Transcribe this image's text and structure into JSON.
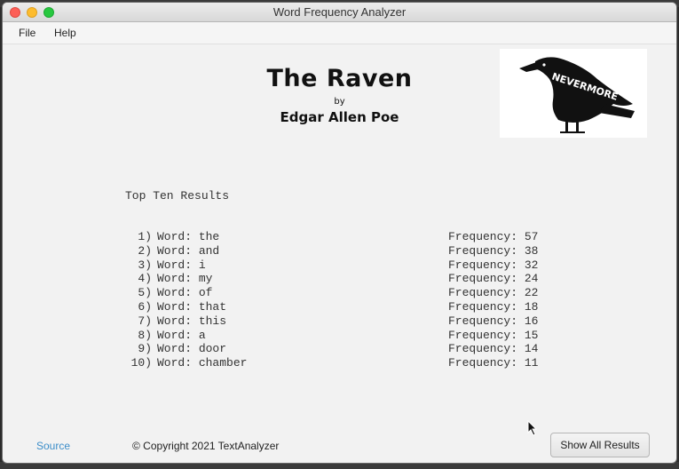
{
  "window": {
    "title": "Word Frequency Analyzer"
  },
  "menu": {
    "file": "File",
    "help": "Help"
  },
  "header": {
    "title": "The Raven",
    "by": "by",
    "author": "Edgar Allen Poe",
    "logo_text": "NEVERMORE"
  },
  "results": {
    "heading": "Top Ten Results",
    "word_prefix": "Word:",
    "freq_prefix": "Frequency:",
    "rows": [
      {
        "rank": "1)",
        "word": "the",
        "frequency": "57"
      },
      {
        "rank": "2)",
        "word": "and",
        "frequency": "38"
      },
      {
        "rank": "3)",
        "word": "i",
        "frequency": "32"
      },
      {
        "rank": "4)",
        "word": "my",
        "frequency": "24"
      },
      {
        "rank": "5)",
        "word": "of",
        "frequency": "22"
      },
      {
        "rank": "6)",
        "word": "that",
        "frequency": "18"
      },
      {
        "rank": "7)",
        "word": "this",
        "frequency": "16"
      },
      {
        "rank": "8)",
        "word": "a",
        "frequency": "15"
      },
      {
        "rank": "9)",
        "word": "door",
        "frequency": "14"
      },
      {
        "rank": "10)",
        "word": "chamber",
        "frequency": "11"
      }
    ]
  },
  "footer": {
    "source": "Source",
    "copyright": "©  Copyright 2021 TextAnalyzer",
    "show_all": "Show All Results"
  },
  "colors": {
    "link": "#3d8ec9",
    "close": "#fc5f57",
    "minimize": "#fdbc2e",
    "maximize": "#28c840"
  }
}
